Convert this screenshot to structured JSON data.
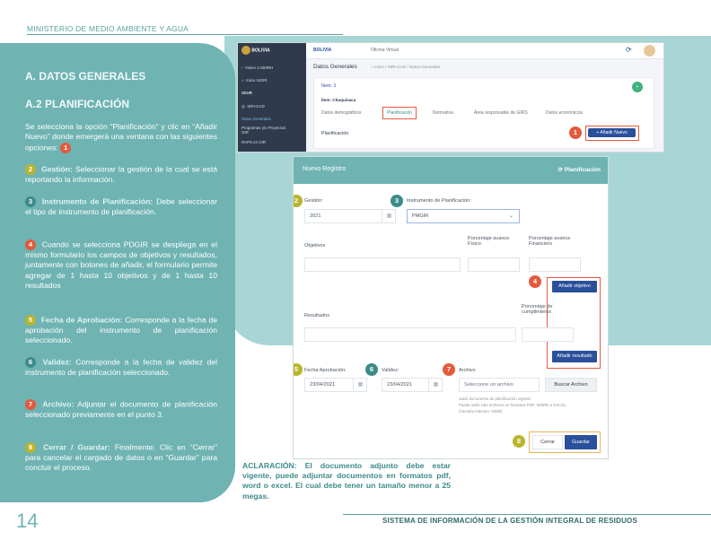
{
  "header": {
    "ministry": "MINISTERIO DE MEDIO AMBIENTE Y AGUA"
  },
  "left": {
    "section_title": "A. DATOS GENERALES",
    "subsection_title": "A.2 PLANIFICACIÓN",
    "intro": "Se selecciona la opción “Planificación” y clic en “Añadir Nuevo” donde emergerá una ventana con las siguientes opciones:",
    "items": [
      {
        "num": "2",
        "key": "Gestión:",
        "text": " Seleccionar la gestión de la cual se está reportando la información."
      },
      {
        "num": "3",
        "key": "Instrumento de Planificación:",
        "text": " Debe seleccionar el tipo de instrumento de planificación."
      },
      {
        "num": "4",
        "key": "",
        "text": " Cuando se selecciona PDGIR se despliega en el mismo formulario los campos de objetivos y resultados, juntamente con botones de añadir, el formulario permite agregar de 1 hasta 10 objetivos y de 1 hasta 10 resultados"
      },
      {
        "num": "5",
        "key": "Fecha de Aprobación:",
        "text": " Corresponde a la fecha de aprobación del instrumento de planificación seleccionado."
      },
      {
        "num": "6",
        "key": "Validez:",
        "text": " Corresponde a la fecha de validez del instrumento de planificación seleccionado."
      },
      {
        "num": "7",
        "key": "Archivo:",
        "text": " Adjuntar el documento de planificación seleccionado previamente en el punto 3."
      },
      {
        "num": "8",
        "key": "Cerrar / Guardar:",
        "text": " Finalmente; Clic en “Cerrar” para cancelar el cargado de datos o en “Guardar” para concluir el proceso."
      }
    ],
    "intro_num": "1"
  },
  "footer": {
    "page_number": "14",
    "system_name": "SISTEMA DE INFORMACIÓN DE LA GESTIÓN INTEGRAL DE RESIDUOS",
    "note": "ACLARACIÓN: El documento adjunto debe estar vigente, puede adjuntar documentos en formatos pdf, word o excel. El cual debe tener un tamaño menor a 25 megas."
  },
  "shot1": {
    "brand": "BOLIVIA",
    "office": "Oficina Virtual",
    "side_items": [
      "Volver a SIMRH",
      "Inicio SIGIR",
      "SIGIR",
      "SIRI-GAD",
      "Datos Generales",
      "Programas y/o Proyectos GIR",
      "RAPS en GIR"
    ],
    "page_title": "Datos Generales",
    "breadcrumb": "Inicio / SIRI-GAD / Datos Generales",
    "item_label": "Ítem: 1",
    "item_name": "Ítem: Chuquisaca",
    "tabs": [
      "Datos demográficos",
      "Planificación",
      "Normativa",
      "Área responsable de GIRS",
      "Datos económicos"
    ],
    "section": "Planificación",
    "add_button": "+ Añadir Nuevo",
    "callout": "1"
  },
  "shot2": {
    "title": "Nuevo Registro",
    "header_right": "Planificación",
    "gestion_label": "Gestión:",
    "gestion_value": "2021",
    "instrumento_label": "Instrumento de Planificación:",
    "instrumento_value": "PMGIR",
    "objetivos_label": "Objetivos",
    "pct_fisico_label": "Porcentaje avance Físico",
    "pct_financiero_label": "Porcentaje avance Financiero",
    "add_objetivo": "Añadir objetivo",
    "resultados_label": "Resultados",
    "pct_cumplimiento_label": "Porcentaje de cumplimiento",
    "add_resultado": "Añadir resultado",
    "fecha_label": "Fecha Aprobación:",
    "fecha_value": "23/04/2021",
    "validez_label": "Validez:",
    "validez_value": "23/04/2021",
    "archivo_label": "Archivo",
    "archivo_placeholder": "Seleccione un archivo",
    "buscar_button": "Buscar Archivo",
    "hint1": "Subir documento de planificación vigente",
    "hint2": "Puede subir solo archivos en formatos PDF, WORD o EXCEL",
    "hint3": "(Tamaño máximo: 25Mb)",
    "cerrar": "Cerrar",
    "guardar": "Guardar",
    "callouts": [
      "2",
      "3",
      "4",
      "5",
      "6",
      "7",
      "8"
    ]
  }
}
